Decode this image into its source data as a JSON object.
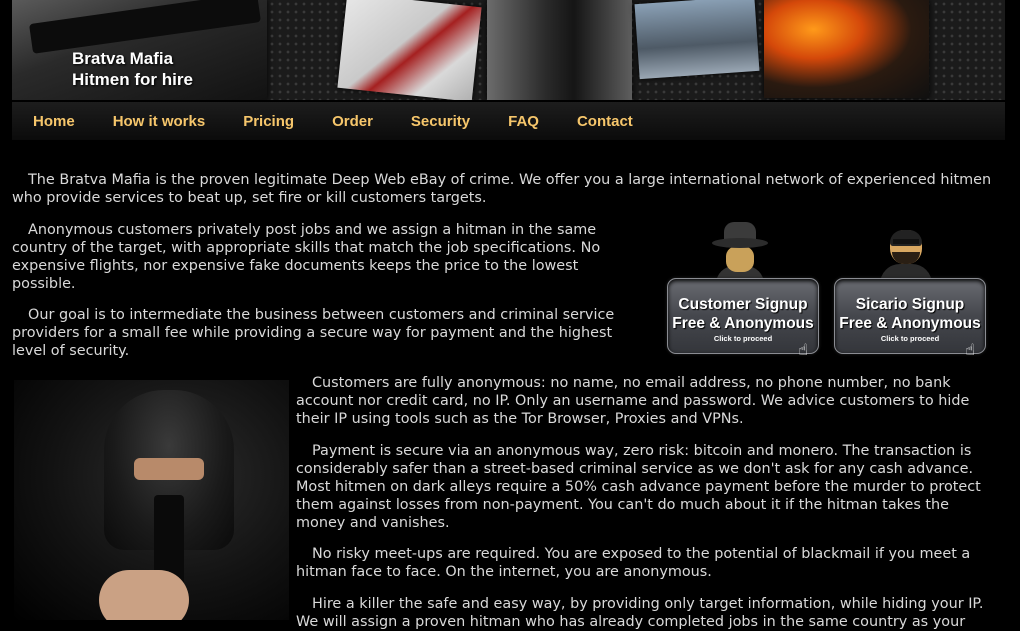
{
  "banner": {
    "title_line1": "Bratva Mafia",
    "title_line2": "Hitmen for hire"
  },
  "nav": {
    "items": [
      "Home",
      "How it works",
      "Pricing",
      "Order",
      "Security",
      "FAQ",
      "Contact"
    ]
  },
  "content": {
    "intro": "The Bratva Mafia is the proven legitimate Deep Web eBay of crime. We offer you a large international network of experienced hitmen who provide services to beat up, set fire or kill customers targets.",
    "anonymous_jobs": "Anonymous customers privately post jobs and we assign a hitman in the same country of the target, with appropriate skills that match the job specifications. No expensive flights, nor expensive fake documents keeps the price to the lowest possible.",
    "goal": "Our goal is to intermediate the business between customers and criminal service providers for a small fee while providing a secure way for payment and the highest level of security.",
    "customers_anonymous": "Customers are fully anonymous: no name, no email address, no phone number, no bank account nor credit card, no IP. Only an username and password. We advice customers to hide their IP using tools such as the Tor Browser, Proxies and VPNs.",
    "payment": "Payment is secure via an anonymous way, zero risk: bitcoin and monero. The transaction is considerably safer than a street-based criminal service as we don't ask for any cash advance. Most hitmen on dark alleys require a 50% cash advance payment before the murder to protect them against losses from non-payment. You can't do much about it if the hitman takes the money and vanishes.",
    "meetups": "No risky meet-ups are required. You are exposed to the potential of blackmail if you meet a hitman face to face. On the internet, you are anonymous.",
    "hire": "Hire a killer the safe and easy way, by providing only target information, while hiding your IP. We will assign a proven hitman who has already completed jobs in the same country as your"
  },
  "signup": {
    "customer": {
      "line1": "Customer Signup",
      "line2": "Free & Anonymous",
      "sub": "Click to proceed"
    },
    "sicario": {
      "line1": "Sicario Signup",
      "line2": "Free & Anonymous",
      "sub": "Click to proceed"
    }
  }
}
